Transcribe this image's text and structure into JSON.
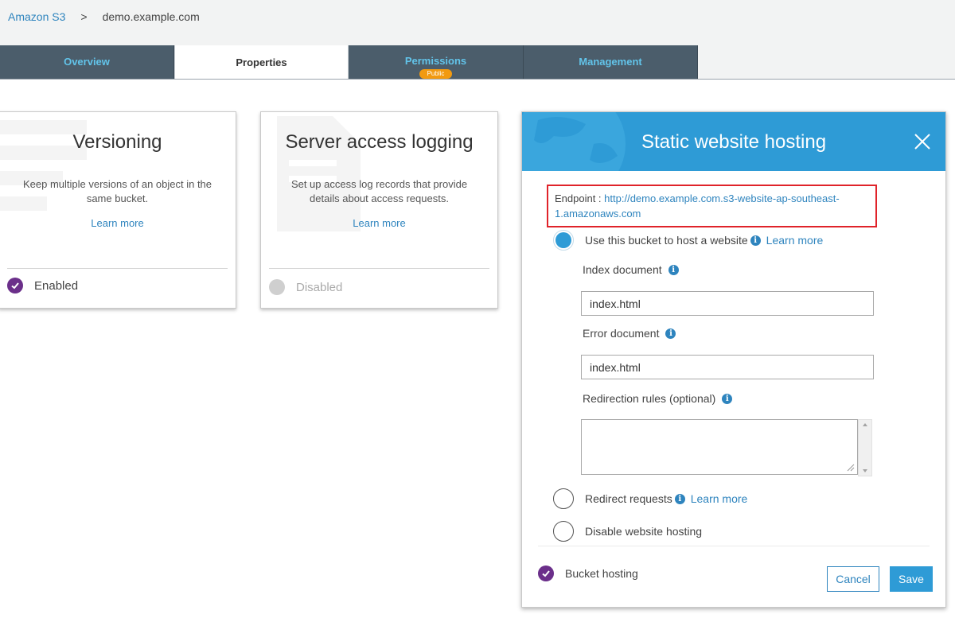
{
  "breadcrumb": {
    "root": "Amazon S3",
    "separator": ">",
    "current": "demo.example.com"
  },
  "tabs": [
    {
      "label": "Overview",
      "active": false
    },
    {
      "label": "Properties",
      "active": true
    },
    {
      "label": "Permissions",
      "active": false,
      "badge": "Public"
    },
    {
      "label": "Management",
      "active": false
    }
  ],
  "cards": {
    "versioning": {
      "title": "Versioning",
      "description": "Keep multiple versions of an object in the same bucket.",
      "learn_more": "Learn more",
      "status": "Enabled"
    },
    "logging": {
      "title": "Server access logging",
      "description": "Set up access log records that provide details about access requests.",
      "learn_more": "Learn more",
      "status": "Disabled"
    }
  },
  "website_panel": {
    "title": "Static website hosting",
    "endpoint_label": "Endpoint :",
    "endpoint_url": "http://demo.example.com.s3-website-ap-southeast-1.amazonaws.com",
    "options": {
      "host": {
        "label": "Use this bucket to host a website",
        "learn_more": "Learn more",
        "selected": true
      },
      "redirect": {
        "label": "Redirect requests",
        "learn_more": "Learn more",
        "selected": false
      },
      "disable": {
        "label": "Disable website hosting",
        "selected": false
      }
    },
    "index_document": {
      "label": "Index document",
      "value": "index.html"
    },
    "error_document": {
      "label": "Error document",
      "value": "index.html"
    },
    "redirection_rules": {
      "label": "Redirection rules (optional)",
      "value": ""
    },
    "footer_status": "Bucket hosting",
    "cancel": "Cancel",
    "save": "Save"
  },
  "colors": {
    "accent": "#2e9bd6",
    "link": "#2e84be",
    "tab_bg": "#4b5d6b",
    "tab_text": "#62c4ea",
    "badge": "#f29a10",
    "check": "#6b2f8a",
    "highlight_border": "#e0232a"
  }
}
